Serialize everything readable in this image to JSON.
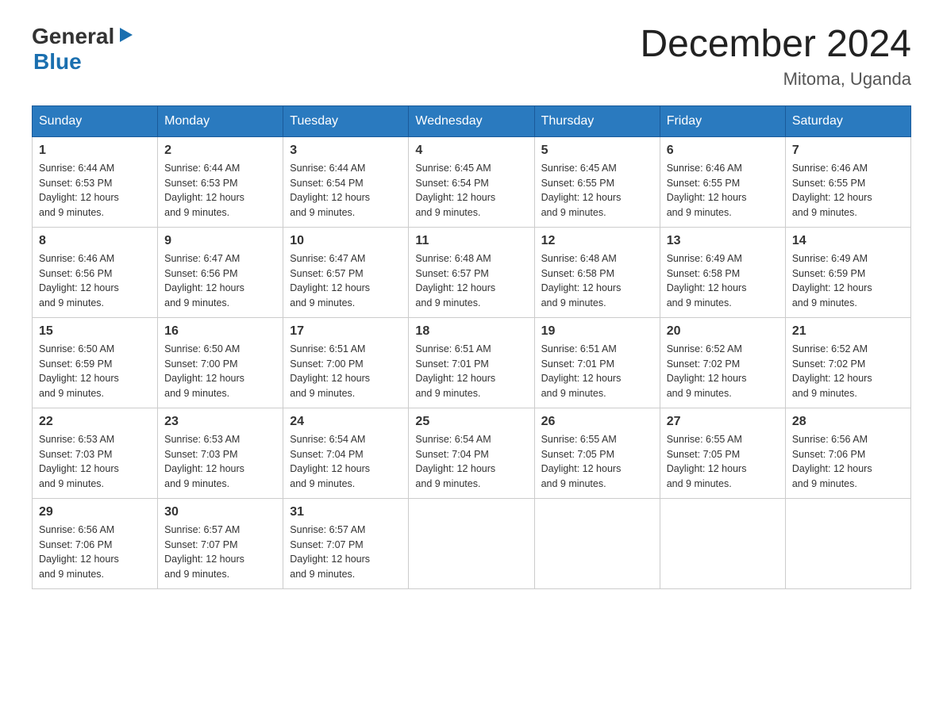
{
  "header": {
    "logo_general": "General",
    "logo_blue": "Blue",
    "month_title": "December 2024",
    "location": "Mitoma, Uganda"
  },
  "days_of_week": [
    "Sunday",
    "Monday",
    "Tuesday",
    "Wednesday",
    "Thursday",
    "Friday",
    "Saturday"
  ],
  "weeks": [
    [
      {
        "day": "1",
        "sunrise": "6:44 AM",
        "sunset": "6:53 PM",
        "daylight": "12 hours and 9 minutes."
      },
      {
        "day": "2",
        "sunrise": "6:44 AM",
        "sunset": "6:53 PM",
        "daylight": "12 hours and 9 minutes."
      },
      {
        "day": "3",
        "sunrise": "6:44 AM",
        "sunset": "6:54 PM",
        "daylight": "12 hours and 9 minutes."
      },
      {
        "day": "4",
        "sunrise": "6:45 AM",
        "sunset": "6:54 PM",
        "daylight": "12 hours and 9 minutes."
      },
      {
        "day": "5",
        "sunrise": "6:45 AM",
        "sunset": "6:55 PM",
        "daylight": "12 hours and 9 minutes."
      },
      {
        "day": "6",
        "sunrise": "6:46 AM",
        "sunset": "6:55 PM",
        "daylight": "12 hours and 9 minutes."
      },
      {
        "day": "7",
        "sunrise": "6:46 AM",
        "sunset": "6:55 PM",
        "daylight": "12 hours and 9 minutes."
      }
    ],
    [
      {
        "day": "8",
        "sunrise": "6:46 AM",
        "sunset": "6:56 PM",
        "daylight": "12 hours and 9 minutes."
      },
      {
        "day": "9",
        "sunrise": "6:47 AM",
        "sunset": "6:56 PM",
        "daylight": "12 hours and 9 minutes."
      },
      {
        "day": "10",
        "sunrise": "6:47 AM",
        "sunset": "6:57 PM",
        "daylight": "12 hours and 9 minutes."
      },
      {
        "day": "11",
        "sunrise": "6:48 AM",
        "sunset": "6:57 PM",
        "daylight": "12 hours and 9 minutes."
      },
      {
        "day": "12",
        "sunrise": "6:48 AM",
        "sunset": "6:58 PM",
        "daylight": "12 hours and 9 minutes."
      },
      {
        "day": "13",
        "sunrise": "6:49 AM",
        "sunset": "6:58 PM",
        "daylight": "12 hours and 9 minutes."
      },
      {
        "day": "14",
        "sunrise": "6:49 AM",
        "sunset": "6:59 PM",
        "daylight": "12 hours and 9 minutes."
      }
    ],
    [
      {
        "day": "15",
        "sunrise": "6:50 AM",
        "sunset": "6:59 PM",
        "daylight": "12 hours and 9 minutes."
      },
      {
        "day": "16",
        "sunrise": "6:50 AM",
        "sunset": "7:00 PM",
        "daylight": "12 hours and 9 minutes."
      },
      {
        "day": "17",
        "sunrise": "6:51 AM",
        "sunset": "7:00 PM",
        "daylight": "12 hours and 9 minutes."
      },
      {
        "day": "18",
        "sunrise": "6:51 AM",
        "sunset": "7:01 PM",
        "daylight": "12 hours and 9 minutes."
      },
      {
        "day": "19",
        "sunrise": "6:51 AM",
        "sunset": "7:01 PM",
        "daylight": "12 hours and 9 minutes."
      },
      {
        "day": "20",
        "sunrise": "6:52 AM",
        "sunset": "7:02 PM",
        "daylight": "12 hours and 9 minutes."
      },
      {
        "day": "21",
        "sunrise": "6:52 AM",
        "sunset": "7:02 PM",
        "daylight": "12 hours and 9 minutes."
      }
    ],
    [
      {
        "day": "22",
        "sunrise": "6:53 AM",
        "sunset": "7:03 PM",
        "daylight": "12 hours and 9 minutes."
      },
      {
        "day": "23",
        "sunrise": "6:53 AM",
        "sunset": "7:03 PM",
        "daylight": "12 hours and 9 minutes."
      },
      {
        "day": "24",
        "sunrise": "6:54 AM",
        "sunset": "7:04 PM",
        "daylight": "12 hours and 9 minutes."
      },
      {
        "day": "25",
        "sunrise": "6:54 AM",
        "sunset": "7:04 PM",
        "daylight": "12 hours and 9 minutes."
      },
      {
        "day": "26",
        "sunrise": "6:55 AM",
        "sunset": "7:05 PM",
        "daylight": "12 hours and 9 minutes."
      },
      {
        "day": "27",
        "sunrise": "6:55 AM",
        "sunset": "7:05 PM",
        "daylight": "12 hours and 9 minutes."
      },
      {
        "day": "28",
        "sunrise": "6:56 AM",
        "sunset": "7:06 PM",
        "daylight": "12 hours and 9 minutes."
      }
    ],
    [
      {
        "day": "29",
        "sunrise": "6:56 AM",
        "sunset": "7:06 PM",
        "daylight": "12 hours and 9 minutes."
      },
      {
        "day": "30",
        "sunrise": "6:57 AM",
        "sunset": "7:07 PM",
        "daylight": "12 hours and 9 minutes."
      },
      {
        "day": "31",
        "sunrise": "6:57 AM",
        "sunset": "7:07 PM",
        "daylight": "12 hours and 9 minutes."
      },
      null,
      null,
      null,
      null
    ]
  ],
  "labels": {
    "sunrise": "Sunrise:",
    "sunset": "Sunset:",
    "daylight": "Daylight:"
  }
}
